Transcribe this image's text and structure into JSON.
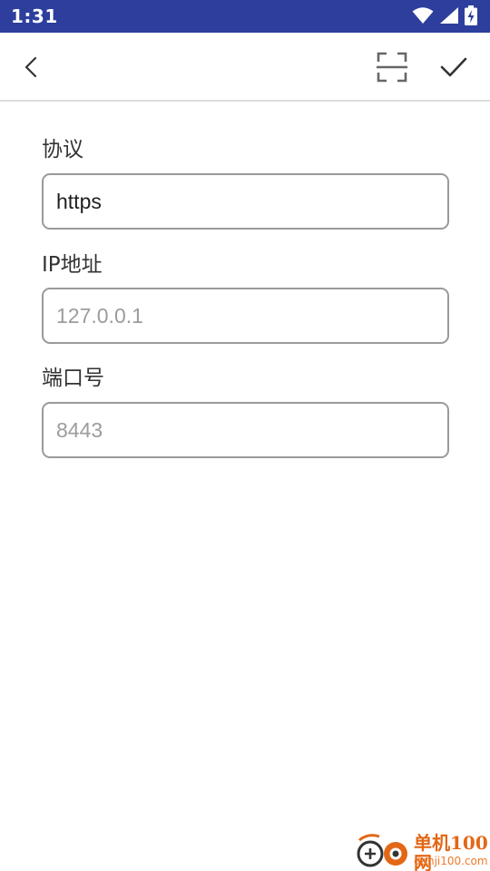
{
  "status_bar": {
    "time": "1:31",
    "icons": [
      "wifi-icon",
      "signal-icon",
      "battery-charging-icon"
    ]
  },
  "app_bar": {
    "back_icon": "chevron-left-icon",
    "scan_icon": "scan-frame-icon",
    "confirm_icon": "check-icon"
  },
  "form": {
    "protocol": {
      "label": "协议",
      "value": "https"
    },
    "ip": {
      "label": "IP地址",
      "placeholder": "127.0.0.1"
    },
    "port": {
      "label": "端口号",
      "placeholder": "8443"
    }
  },
  "watermark": {
    "name": "单机100网",
    "url": "danji100.com"
  },
  "colors": {
    "status_bar": "#2d3e9c",
    "field_border": "#9a9a9a",
    "placeholder": "#9c9c9c",
    "watermark": "#e26716"
  }
}
